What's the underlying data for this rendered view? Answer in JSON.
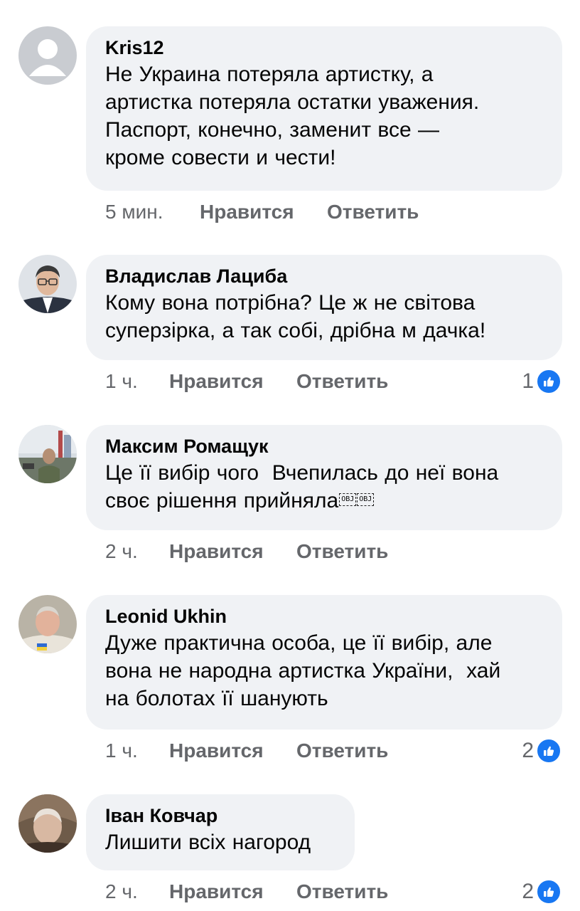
{
  "meta_labels": {
    "like": "Нравится",
    "reply": "Ответить"
  },
  "colors": {
    "bubble": "#f0f2f5",
    "meta_text": "#65676b",
    "like_badge": "#1877f2"
  },
  "comments": [
    {
      "author": "Kris12",
      "text": "Не Украина потеряла артистку, а\nартистка потеряла остатки уважения.\nПаспорт, конечно, заменит все —\nкроме совести и чести!",
      "time": "5 мин.",
      "reactions": null,
      "avatar": "default-avatar-icon"
    },
    {
      "author": "Владислав Лациба",
      "text": "Кому вона потрібна? Це ж не світова\nсуперзірка, а так собі, дрібна м дачка!",
      "time": "1 ч.",
      "reactions": "1",
      "avatar": "user-photo"
    },
    {
      "author": "Максим Ромащук",
      "text": "Це її вибір чого  Вчепилась до неї вона\nсвоє рішення прийняла",
      "obj_glyphs": [
        "OBJ",
        "OBJ"
      ],
      "time": "2 ч.",
      "reactions": null,
      "avatar": "user-photo"
    },
    {
      "author": "Leonid Ukhin",
      "text": "Дуже практична особа, це її вибір, але\nвона не народна артистка України,  хай\nна болотах її шанують",
      "time": "1 ч.",
      "reactions": "2",
      "avatar": "user-photo"
    },
    {
      "author": "Іван Ковчар",
      "text": "Лишити всіх нагород",
      "time": "2 ч.",
      "reactions": "2",
      "avatar": "user-photo"
    }
  ]
}
